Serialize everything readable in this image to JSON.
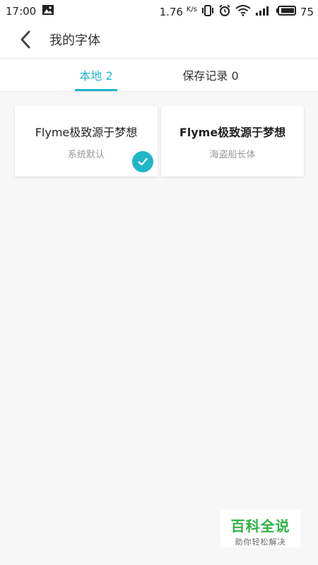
{
  "status_bar": {
    "time": "17:00",
    "speed": "1.76",
    "speed_unit": "K/s",
    "battery": "75",
    "icons": [
      "image-notification-icon",
      "vibrate-icon",
      "alarm-icon",
      "wifi-icon",
      "signal-icon",
      "battery-icon"
    ]
  },
  "header": {
    "back_icon": "back-arrow-icon",
    "title": "我的字体"
  },
  "tabs": [
    {
      "label": "本地 2",
      "active": true
    },
    {
      "label": "保存记录 0",
      "active": false
    }
  ],
  "fonts": [
    {
      "name": "Flyme极致源于梦想",
      "description": "系统默认",
      "selected": true
    },
    {
      "name": "Flyme极致源于梦想",
      "description": "海盗船长体",
      "selected": false
    }
  ],
  "watermark": {
    "title": "百科全说",
    "subtitle": "助你轻松解决"
  },
  "colors": {
    "accent": "#1fb6c8",
    "watermark_green": "#2fb344"
  }
}
